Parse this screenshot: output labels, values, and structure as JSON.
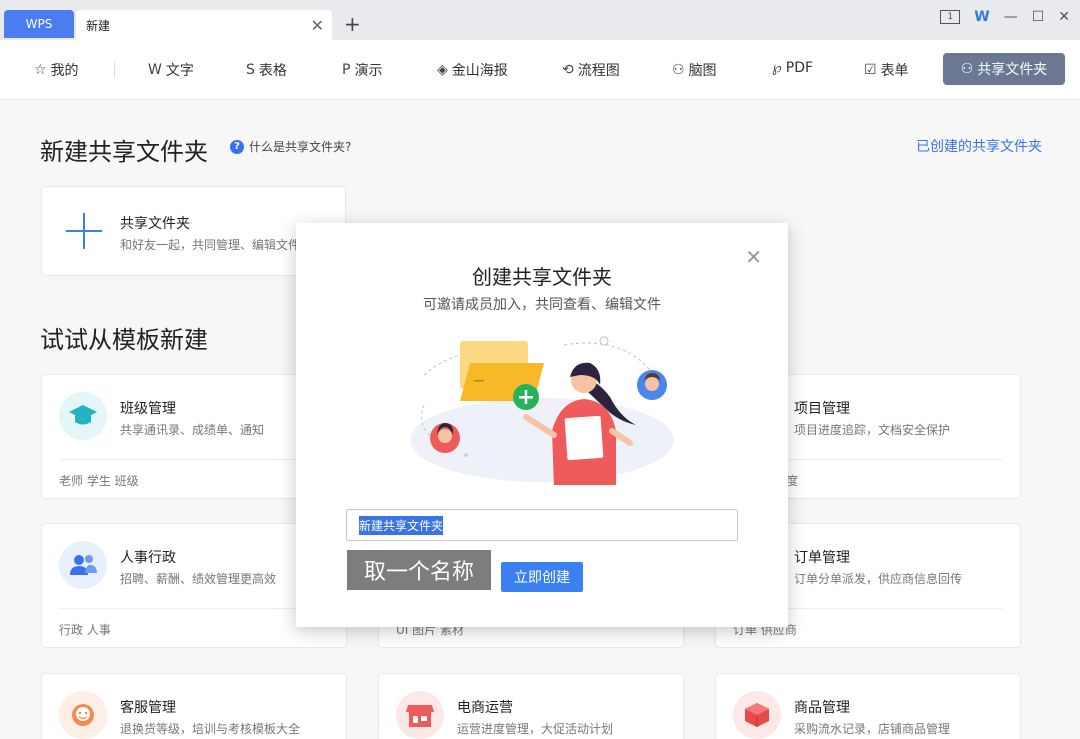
{
  "titlebar": {
    "wps_tab": "WPS",
    "doc_tab": "新建",
    "close_glyph": "✕",
    "add_glyph": "+",
    "kbd_badge": "1"
  },
  "nav": {
    "items": [
      {
        "label": "我的",
        "icon": "☆"
      },
      {
        "label": "文字",
        "icon": "W"
      },
      {
        "label": "表格",
        "icon": "S"
      },
      {
        "label": "演示",
        "icon": "P"
      },
      {
        "label": "金山海报",
        "icon": "◈"
      },
      {
        "label": "流程图",
        "icon": "⟲"
      },
      {
        "label": "脑图",
        "icon": "⚇"
      },
      {
        "label": "PDF",
        "icon": "℘"
      },
      {
        "label": "表单",
        "icon": "☑"
      }
    ],
    "active": {
      "label": "共享文件夹",
      "icon": "⚇"
    }
  },
  "main": {
    "title": "新建共享文件夹",
    "help_text": "什么是共享文件夹?",
    "created_link": "已创建的共享文件夹",
    "new_card": {
      "title": "共享文件夹",
      "sub": "和好友一起，共同管理、编辑文件"
    },
    "templates_title": "试试从模板新建"
  },
  "templates": [
    {
      "title": "班级管理",
      "sub": "共享通讯录、成绩单、通知",
      "tags": "老师   学生   班级"
    },
    {
      "title": "项目管理",
      "sub": "项目进度追踪，文档安全保护",
      "tags": "度"
    },
    {
      "title": "人事行政",
      "sub": "招聘、薪酬、绩效管理更高效",
      "tags": "行政   人事"
    },
    {
      "title": "",
      "sub": "",
      "tags": "UI   图片   素材"
    },
    {
      "title": "订单管理",
      "sub": "订单分单派发，供应商信息回传",
      "tags": "订单   供应商"
    },
    {
      "title": "客服管理",
      "sub": "退换货等级，培训与考核模板大全",
      "tags": ""
    },
    {
      "title": "电商运营",
      "sub": "运营进度管理，大促活动计划",
      "tags": ""
    },
    {
      "title": "商品管理",
      "sub": "采购流水记录，店铺商品管理",
      "tags": ""
    }
  ],
  "modal": {
    "title": "创建共享文件夹",
    "subtitle": "可邀请成员加入，共同查看、编辑文件",
    "input_value": "新建共享文件夹",
    "tip": "取一个名称",
    "create_button": "立即创建"
  },
  "colors": {
    "accent": "#3a80f0",
    "nav_active": "#6a7893",
    "wps_tab": "#4b7df0"
  }
}
